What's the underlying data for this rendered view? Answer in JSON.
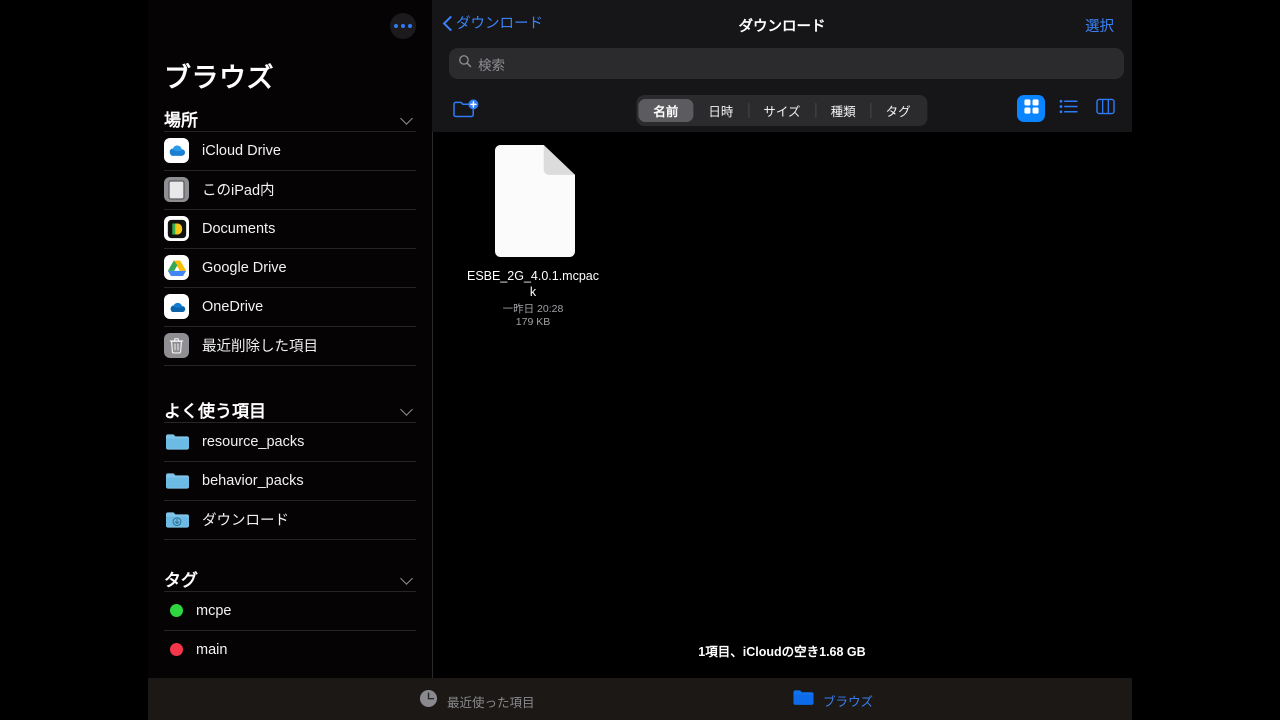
{
  "sidebar": {
    "title": "ブラウズ",
    "more_button": "more-options",
    "sections": [
      {
        "header": "場所",
        "items": [
          {
            "label": "iCloud Drive",
            "icon": "icloud-drive-icon"
          },
          {
            "label": "このiPad内",
            "icon": "ipad-icon"
          },
          {
            "label": "Documents",
            "icon": "documents-app-icon"
          },
          {
            "label": "Google Drive",
            "icon": "google-drive-icon"
          },
          {
            "label": "OneDrive",
            "icon": "onedrive-icon"
          },
          {
            "label": "最近削除した項目",
            "icon": "trash-icon"
          }
        ]
      },
      {
        "header": "よく使う項目",
        "items": [
          {
            "label": "resource_packs",
            "icon": "folder-icon"
          },
          {
            "label": "behavior_packs",
            "icon": "folder-icon"
          },
          {
            "label": "ダウンロード",
            "icon": "downloads-folder-icon"
          }
        ]
      },
      {
        "header": "タグ",
        "items": [
          {
            "label": "mcpe",
            "icon": "tag-dot-green",
            "color": "#30d63f"
          },
          {
            "label": "main",
            "icon": "tag-dot-red",
            "color": "#f4354a"
          }
        ]
      }
    ]
  },
  "nav": {
    "back_label": "ダウンロード",
    "title": "ダウンロード",
    "select_label": "選択"
  },
  "search": {
    "placeholder": "検索",
    "value": "",
    "icon": "search-icon"
  },
  "toolbar": {
    "new_folder_icon": "new-folder-icon",
    "sort_options": [
      "名前",
      "日時",
      "サイズ",
      "種類",
      "タグ"
    ],
    "sort_selected": "名前",
    "view_modes": [
      {
        "name": "grid-view",
        "icon": "grid-icon",
        "active": true
      },
      {
        "name": "list-view",
        "icon": "list-icon",
        "active": false
      },
      {
        "name": "column-view",
        "icon": "columns-icon",
        "active": false
      }
    ]
  },
  "files": [
    {
      "name": "ESBE_2G_4.0.1.mcpack",
      "date": "一昨日 20:28",
      "size": "179 KB",
      "icon": "document-icon"
    }
  ],
  "status": "1項目、iCloudの空き1.68 GB",
  "tabbar": {
    "recents_label": "最近使った項目",
    "recents_icon": "clock-icon",
    "browse_label": "ブラウズ",
    "browse_icon": "folder-filled-icon"
  },
  "colors": {
    "accent_blue": "#0a84ff",
    "link_blue": "#3b82f6",
    "tag_green": "#30d63f",
    "tag_red": "#f4354a",
    "background": "#000000",
    "chrome": "#161618"
  }
}
